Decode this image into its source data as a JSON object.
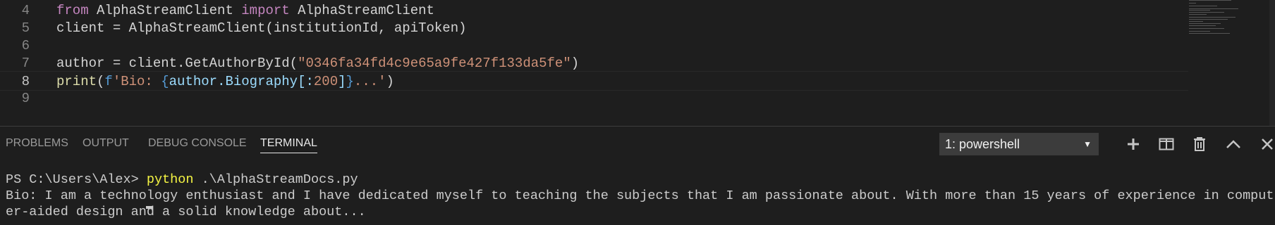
{
  "editor": {
    "lines": [
      {
        "num": "4",
        "tokens": [
          {
            "text": "from",
            "cls": "kw"
          },
          {
            "text": " ",
            "cls": "plain"
          },
          {
            "text": "AlphaStreamClient",
            "cls": "plain"
          },
          {
            "text": " ",
            "cls": "plain"
          },
          {
            "text": "import",
            "cls": "kw"
          },
          {
            "text": " AlphaStreamClient",
            "cls": "plain"
          }
        ]
      },
      {
        "num": "5",
        "tokens": [
          {
            "text": "client = AlphaStreamClient(institutionId, apiToken)",
            "cls": "plain"
          }
        ]
      },
      {
        "num": "6",
        "tokens": []
      },
      {
        "num": "7",
        "tokens": [
          {
            "text": "author = client.GetAuthorById(",
            "cls": "plain"
          },
          {
            "text": "\"0346fa34fd4c9e65a9fe427f133da5fe\"",
            "cls": "str"
          },
          {
            "text": ")",
            "cls": "plain"
          }
        ]
      },
      {
        "num": "8",
        "tokens": [
          {
            "text": "print",
            "cls": "fn"
          },
          {
            "text": "(",
            "cls": "plain"
          },
          {
            "text": "f",
            "cls": "brace"
          },
          {
            "text": "'Bio: ",
            "cls": "str"
          },
          {
            "text": "{",
            "cls": "brace"
          },
          {
            "text": "author.Biography[:",
            "cls": "var"
          },
          {
            "text": "200",
            "cls": "str"
          },
          {
            "text": "]",
            "cls": "var"
          },
          {
            "text": "}",
            "cls": "brace"
          },
          {
            "text": "...'",
            "cls": "str"
          },
          {
            "text": ")",
            "cls": "plain"
          }
        ],
        "current": true
      },
      {
        "num": "9",
        "tokens": []
      }
    ]
  },
  "panel": {
    "tabs": [
      {
        "label": "PROBLEMS",
        "name": "tab-problems"
      },
      {
        "label": "OUTPUT",
        "name": "tab-output"
      },
      {
        "label": "DEBUG CONSOLE",
        "name": "tab-debug-console"
      },
      {
        "label": "TERMINAL",
        "name": "tab-terminal",
        "active": true
      }
    ],
    "terminal_select": {
      "value": "1: powershell"
    },
    "actions": [
      {
        "name": "new-terminal-icon"
      },
      {
        "name": "split-terminal-icon"
      },
      {
        "name": "kill-terminal-icon"
      },
      {
        "name": "maximize-panel-icon"
      },
      {
        "name": "close-panel-icon"
      }
    ]
  },
  "terminal": {
    "prompt": "PS C:\\Users\\Alex> ",
    "command": "python",
    "args": " .\\AlphaStreamDocs.py",
    "output_line1": "Bio: I am a technology enthusiast and I have dedicated myself to teaching the subjects that I am passionate about. With more than 15 years of experience in comput",
    "output_line2": "er-aided design and a solid knowledge about..."
  }
}
